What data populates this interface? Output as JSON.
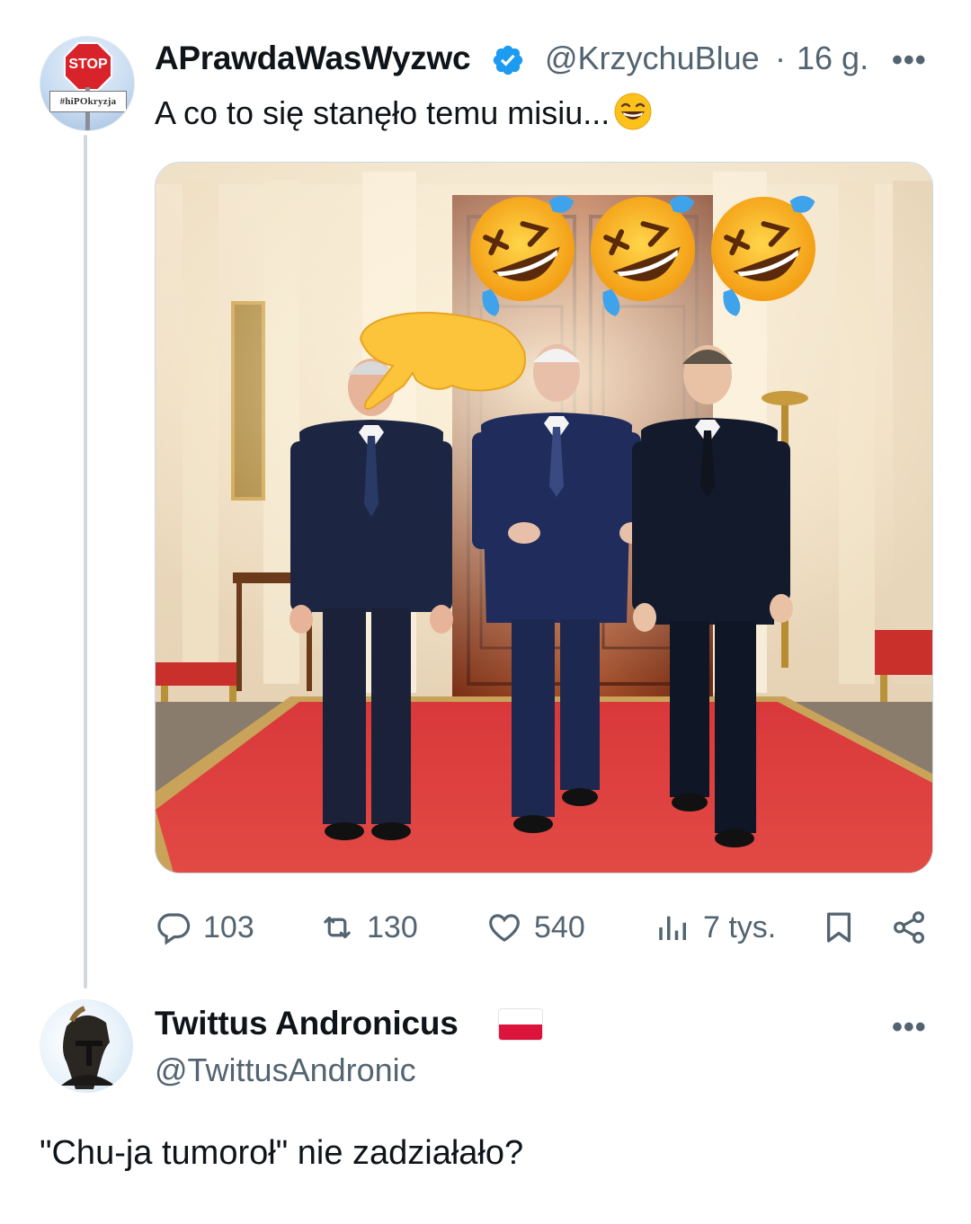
{
  "tweet": {
    "author_name": "APrawdaWasWyzwc",
    "handle": "@KrzychuBlue",
    "separator": "·",
    "time": "16 g.",
    "more": "•••",
    "text": "A co to się stanęło temu misiu...",
    "avatar": {
      "sign_text": "STOP",
      "plate_text": "#hiPOkryzja"
    },
    "image_emoji": [
      "rolling-on-the-floor-laughing",
      "rolling-on-the-floor-laughing",
      "rolling-on-the-floor-laughing",
      "backhand-index-pointing-right"
    ],
    "stats": {
      "replies": "103",
      "retweets": "130",
      "likes": "540",
      "views": "7 tys."
    },
    "icons": {
      "reply": "reply-icon",
      "retweet": "retweet-icon",
      "like": "heart-icon",
      "views": "views-icon",
      "bookmark": "bookmark-icon",
      "share": "share-icon",
      "verified": "verified-badge-icon"
    }
  },
  "reply": {
    "author_name": "Twittus Andronicus",
    "handle": "@TwittusAndronic",
    "more": "•••",
    "flag": "poland-flag-icon",
    "text": "\"Chu-ja tumoroł\" nie zadziałało?"
  },
  "colors": {
    "text": "#0f1419",
    "secondary": "#536471",
    "verified": "#1d9bf0",
    "thread_line": "#cfd9de",
    "flag_red": "#dc143c"
  }
}
